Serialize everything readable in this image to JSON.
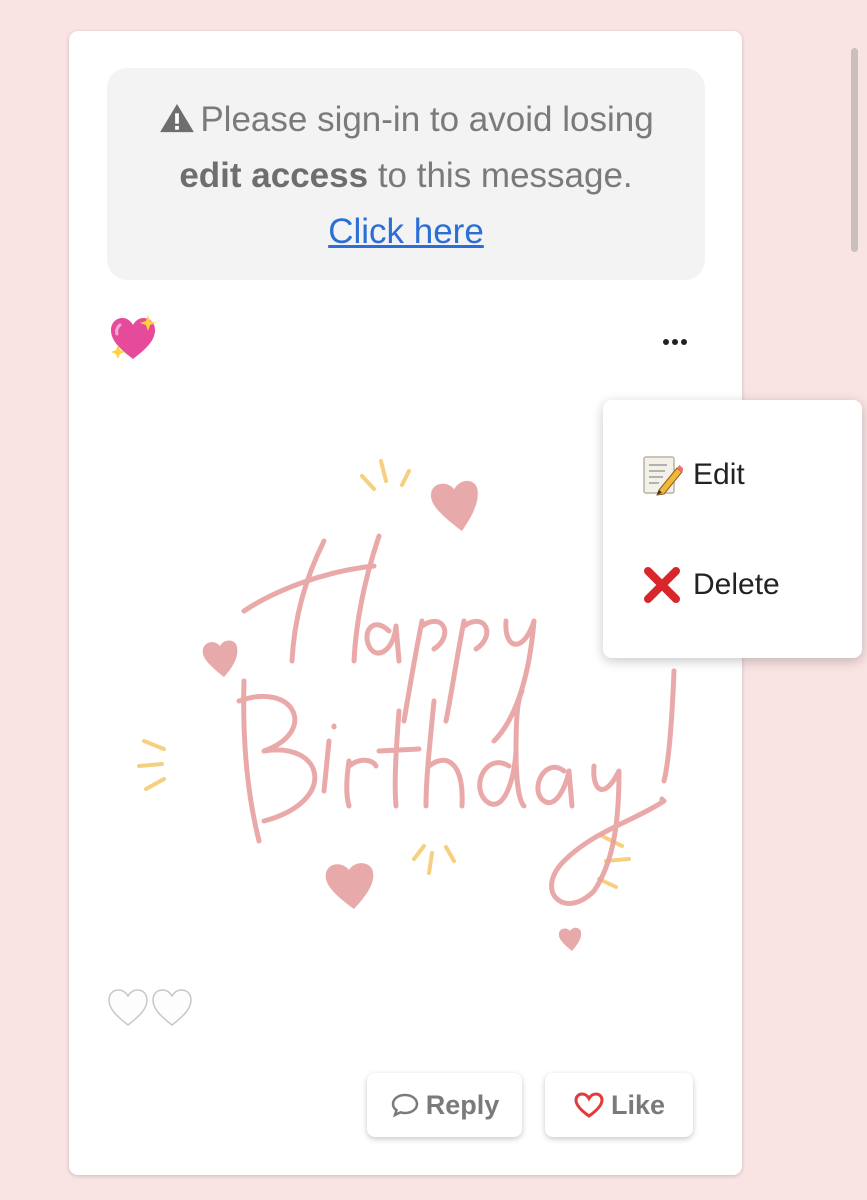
{
  "notice": {
    "icon": "warning-triangle-icon",
    "text_before": "Please sign-in to avoid losing",
    "text_bold": "edit access",
    "text_after": "to this message.",
    "link_label": "Click here"
  },
  "post": {
    "top_emoji": "sparkling-heart-icon",
    "more_icon": "more-options-icon",
    "artwork_text": [
      "Happy",
      "Birthday!"
    ],
    "reactions": [
      "white-heart-icon",
      "white-heart-icon"
    ]
  },
  "actions": {
    "reply_label": "Reply",
    "like_label": "Like"
  },
  "menu": {
    "items": [
      {
        "label": "Edit",
        "icon": "memo-pencil-icon"
      },
      {
        "label": "Delete",
        "icon": "red-cross-icon"
      }
    ]
  },
  "colors": {
    "page_bg": "#f9e3e3",
    "link": "#2b6fd6",
    "like_heart": "#e33b3b",
    "artwork_pink": "#e8a0a0"
  }
}
